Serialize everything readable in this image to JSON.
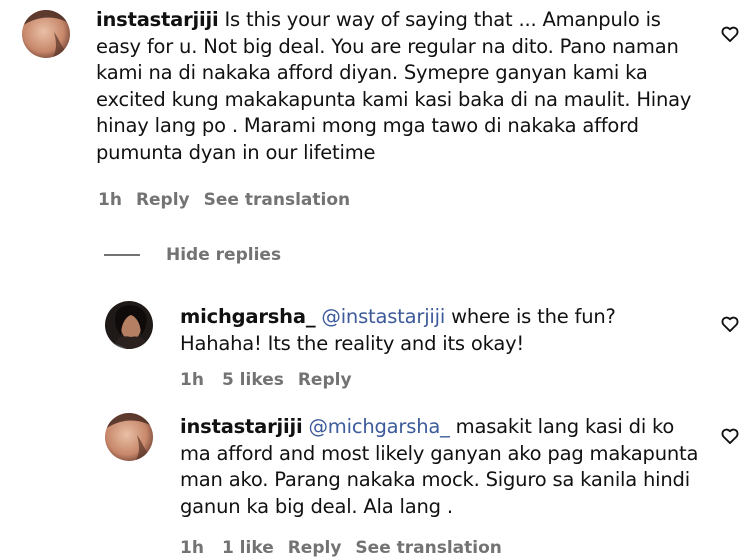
{
  "comments": [
    {
      "username": "instastarjiji",
      "mention": "",
      "text": "Is this your way of saying that ... Amanpulo is easy for u. Not big deal. You are regular na dito. Pano naman kami na di nakaka afford diyan. Symepre ganyan kami ka excited kung makakapunta kami kasi baka di na maulit. Hinay hinay lang po . Marami mong mga tawo di nakaka afford pumunta dyan in our lifetime",
      "time": "1h",
      "likes": "",
      "reply_label": "Reply",
      "translation_label": "See translation",
      "heart_icon": "heart-outline-icon"
    },
    {
      "username": "michgarsha_",
      "mention": "@instastarjiji",
      "text": "where is the fun? Hahaha! Its the reality and its okay!",
      "time": "1h",
      "likes": "5 likes",
      "reply_label": "Reply",
      "translation_label": "",
      "heart_icon": "heart-outline-icon"
    },
    {
      "username": "instastarjiji",
      "mention": "@michgarsha_",
      "text": "masakit lang kasi di ko ma afford and most likely ganyan ako pag makapunta man ako. Parang nakaka mock. Siguro sa kanila hindi ganun ka big deal. Ala lang .",
      "time": "1h",
      "likes": "1 like",
      "reply_label": "Reply",
      "translation_label": "See translation",
      "heart_icon": "heart-outline-icon"
    }
  ],
  "thread": {
    "hide_replies_label": "Hide replies"
  },
  "colors": {
    "text": "#111111",
    "meta": "#737373",
    "mention": "#3d5a9a"
  }
}
